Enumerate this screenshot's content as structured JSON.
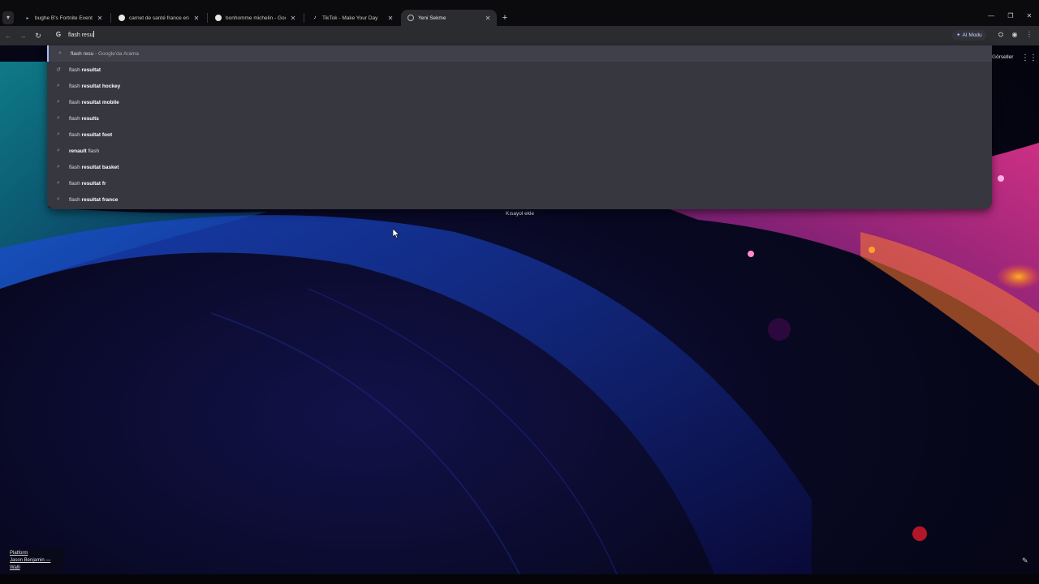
{
  "browser": {
    "tabs": [
      {
        "title": "bughe B's Fortnite Events - Fort",
        "favicon": "fortnite-icon",
        "active": false
      },
      {
        "title": "carnet de santé france enfant -",
        "favicon": "google-icon",
        "active": false
      },
      {
        "title": "bonhomme michelin - Google -",
        "favicon": "google-icon",
        "active": false
      },
      {
        "title": "TikTok - Make Your Day",
        "favicon": "tiktok-icon",
        "active": false
      },
      {
        "title": "Yeni Sekme",
        "favicon": "chrome-icon",
        "active": true
      }
    ],
    "omnibox": {
      "value": "flash resu",
      "engine": "G"
    },
    "ai_mode_label": "AI Modu",
    "accent_color": "#a8b9ff"
  },
  "suggestions": [
    {
      "typed": "flash resu",
      "completion": "",
      "suffix": " - Google'da Arama",
      "icon": "search-icon"
    },
    {
      "typed": "flash ",
      "completion": "resultat",
      "suffix": "",
      "icon": "history-icon"
    },
    {
      "typed": "flash ",
      "completion": "resultat hockey",
      "suffix": "",
      "icon": "search-icon"
    },
    {
      "typed": "flash ",
      "completion": "resultat mobile",
      "suffix": "",
      "icon": "search-icon"
    },
    {
      "typed": "flash ",
      "completion": "results",
      "suffix": "",
      "icon": "search-icon"
    },
    {
      "typed": "flash ",
      "completion": "resultat foot",
      "suffix": "",
      "icon": "search-icon"
    },
    {
      "typed": "",
      "completion": "renault",
      "suffix": " flash",
      "icon": "search-icon"
    },
    {
      "typed": "flash ",
      "completion": "resultat basket",
      "suffix": "",
      "icon": "search-icon"
    },
    {
      "typed": "flash ",
      "completion": "resultat fr",
      "suffix": "",
      "icon": "search-icon"
    },
    {
      "typed": "flash ",
      "completion": "resultat france",
      "suffix": "",
      "icon": "search-icon"
    }
  ],
  "newtab": {
    "images_label": "Görseller",
    "add_shortcut_label": "Kısayol ekle"
  },
  "credit": {
    "line1": "Platform",
    "line2": "Jason Benjamin — Walli"
  }
}
